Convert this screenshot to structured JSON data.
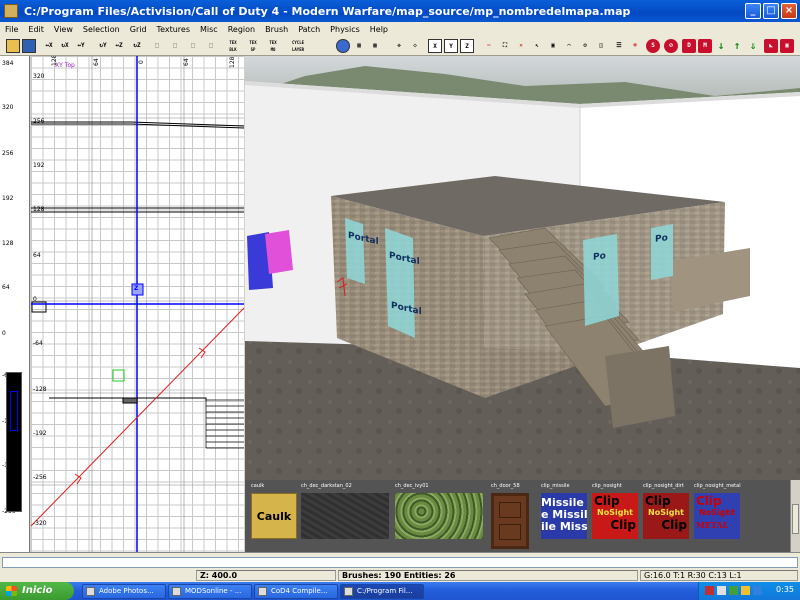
{
  "window": {
    "title": "C:/Program Files/Activision/Call of Duty 4 - Modern Warfare/map_source/mp_nombredelmapa.map"
  },
  "titlebar_buttons": {
    "minimize": "_",
    "maximize": "□",
    "close": "×"
  },
  "menu": [
    "File",
    "Edit",
    "View",
    "Selection",
    "Grid",
    "Textures",
    "Misc",
    "Region",
    "Brush",
    "Patch",
    "Physics",
    "Help"
  ],
  "toolbar": {
    "icons": [
      "open-icon",
      "save-icon",
      "flip-x-icon",
      "rotate-x-icon",
      "flip-y-icon",
      "rotate-y-icon",
      "flip-z-icon",
      "rotate-z-icon",
      "select-complete-icon",
      "select-touching-icon",
      "select-partial-icon",
      "select-inside-icon",
      "csg-subtract-icon",
      "csg-merge-icon",
      "hollow-icon",
      "clipper-icon",
      "change-view-icon",
      "texture-view-icon",
      "cubic-clip-icon",
      "camera-move-icon",
      "x-axis-icon",
      "y-axis-icon",
      "z-axis-icon",
      "entity-icon",
      "patch-icon",
      "curve-icon",
      "gear-icon",
      "redraw-icon",
      "filter-icon",
      "light-icon",
      "sound-icon",
      "model-icon",
      "color-icon",
      "arrow-down-icon",
      "arrow-up-icon",
      "down-green-icon",
      "vertex-icon",
      "edge-icon"
    ],
    "labels": {
      "cycle": "CYCLE LAYER",
      "tex1": "TEX BLK",
      "tex2": "TEX SP",
      "tex3": "TEX MO"
    }
  },
  "left_ruler": {
    "ticks": [
      "384",
      "320",
      "256",
      "192",
      "128",
      "64",
      "0",
      "-64",
      "-128",
      "-192",
      "-256"
    ]
  },
  "grid_view": {
    "view_label": "XY Top",
    "top_labels": [
      "128",
      "64",
      "0",
      "64",
      "128"
    ],
    "side_labels": [
      "320",
      "256",
      "192",
      "128",
      "64",
      "0",
      "-64",
      "-128",
      "-192",
      "-256",
      "-320"
    ],
    "axis_marker": "Z"
  },
  "viewport": {
    "portal_label": "Portal",
    "portal_label_short": "Po"
  },
  "texture_browser": {
    "textures": [
      {
        "name": "caulk",
        "label": "Caulk"
      },
      {
        "name": "ch_dec_darkstan_02",
        "label": ""
      },
      {
        "name": "ch_dec_ivy01",
        "label": ""
      },
      {
        "name": "ch_door_58",
        "label": ""
      },
      {
        "name": "clip_missile",
        "label": "Missile"
      },
      {
        "name": "clip_nosight",
        "label": "Clip"
      },
      {
        "name": "clip_nosight_dirt",
        "label": "Clip"
      },
      {
        "name": "clip_nosight_metal",
        "label": "Clip"
      }
    ],
    "missile_lines": [
      "Missile",
      "e Missil",
      "ile Miss"
    ],
    "nosight_text": "NoSight",
    "metal_text": "METAL"
  },
  "status": {
    "z": "Z: 400.0",
    "brushes": "Brushes: 190 Entities: 26",
    "grid": "G:16.0 T:1 R:30 C:13 L:1"
  },
  "taskbar": {
    "start": "Inicio",
    "tasks": [
      "Adobe Photos...",
      "MODSonline - ...",
      "CoD4 Compile...",
      "C:/Program Fil..."
    ],
    "clock": "0:35"
  },
  "colors": {
    "title_blue": "#0349c4",
    "axis_blue": "#0000ff",
    "red_line": "#e02020",
    "taskbar_blue": "#245edb",
    "start_green": "#3a9a2f"
  }
}
